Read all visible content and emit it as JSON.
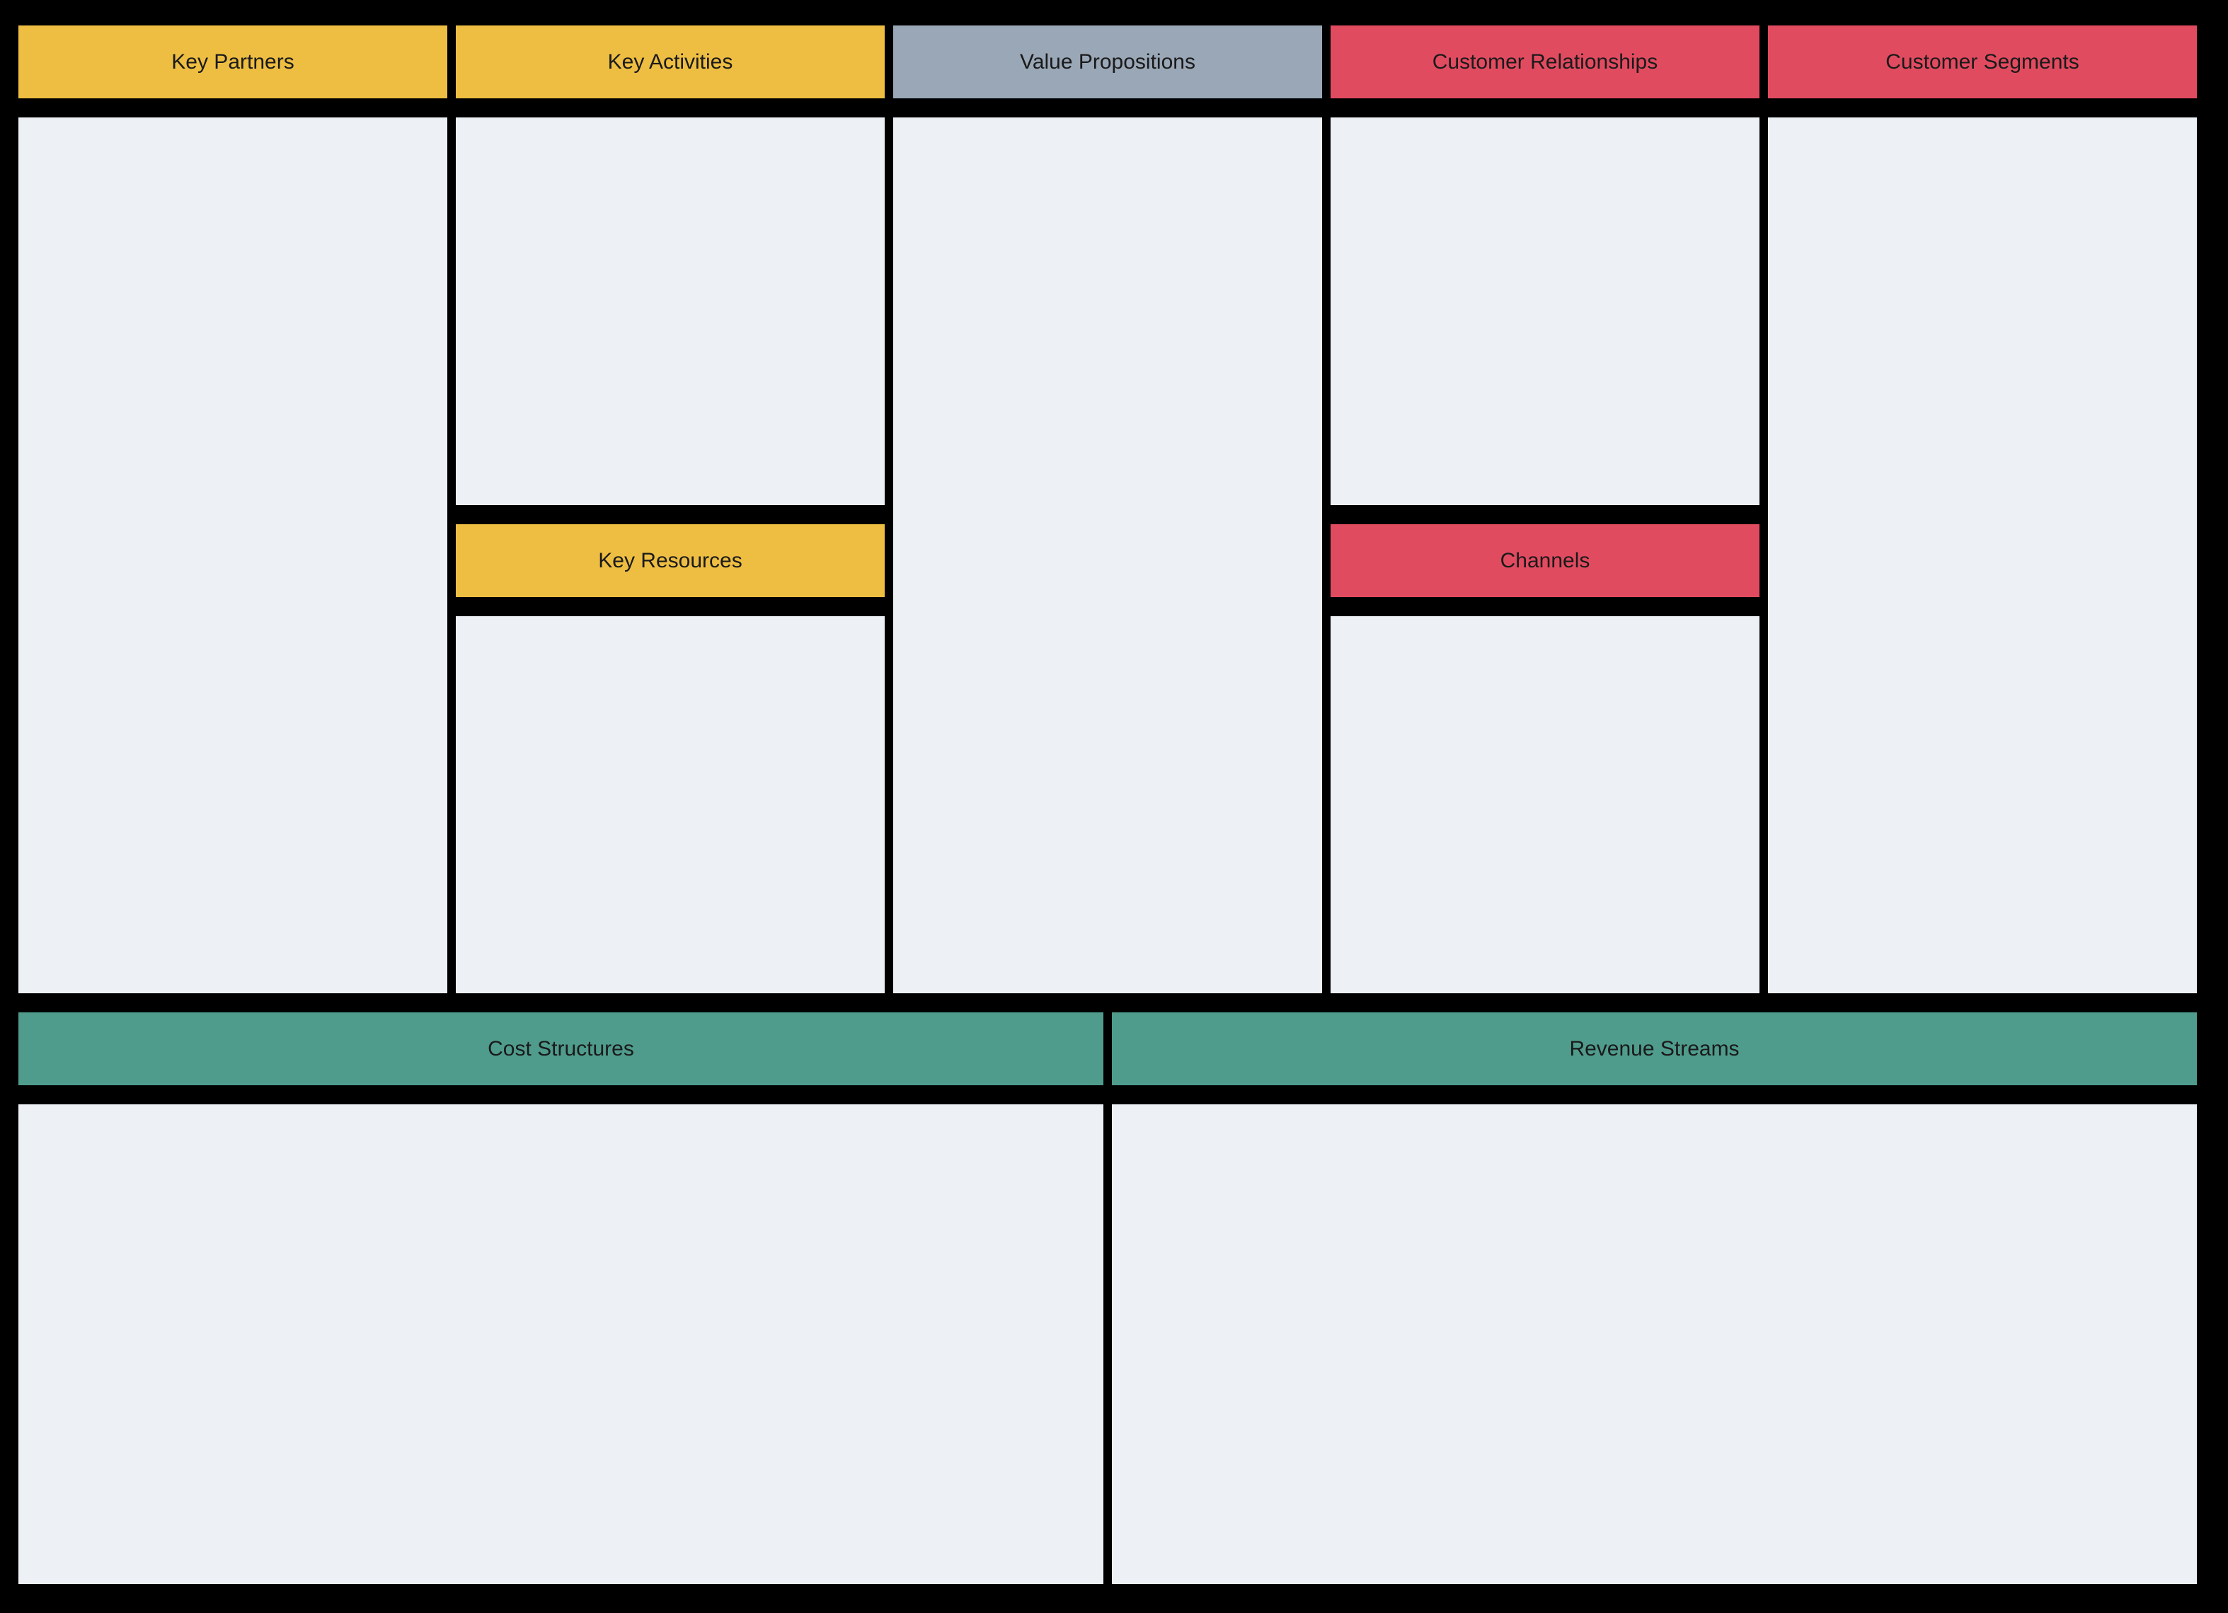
{
  "canvas": {
    "key_partners": "Key Partners",
    "key_activities": "Key Activities",
    "value_propositions": "Value Propositions",
    "customer_relationships": "Customer Relationships",
    "customer_segments": "Customer Segments",
    "key_resources": "Key Resources",
    "channels": "Channels",
    "cost_structures": "Cost Structures",
    "revenue_streams": "Revenue Streams"
  },
  "colors": {
    "yellow": "#eebe42",
    "gray": "#9aa7b7",
    "red": "#e14b60",
    "teal": "#4f9c8d",
    "body": "#edf1f6",
    "border": "#000000"
  }
}
